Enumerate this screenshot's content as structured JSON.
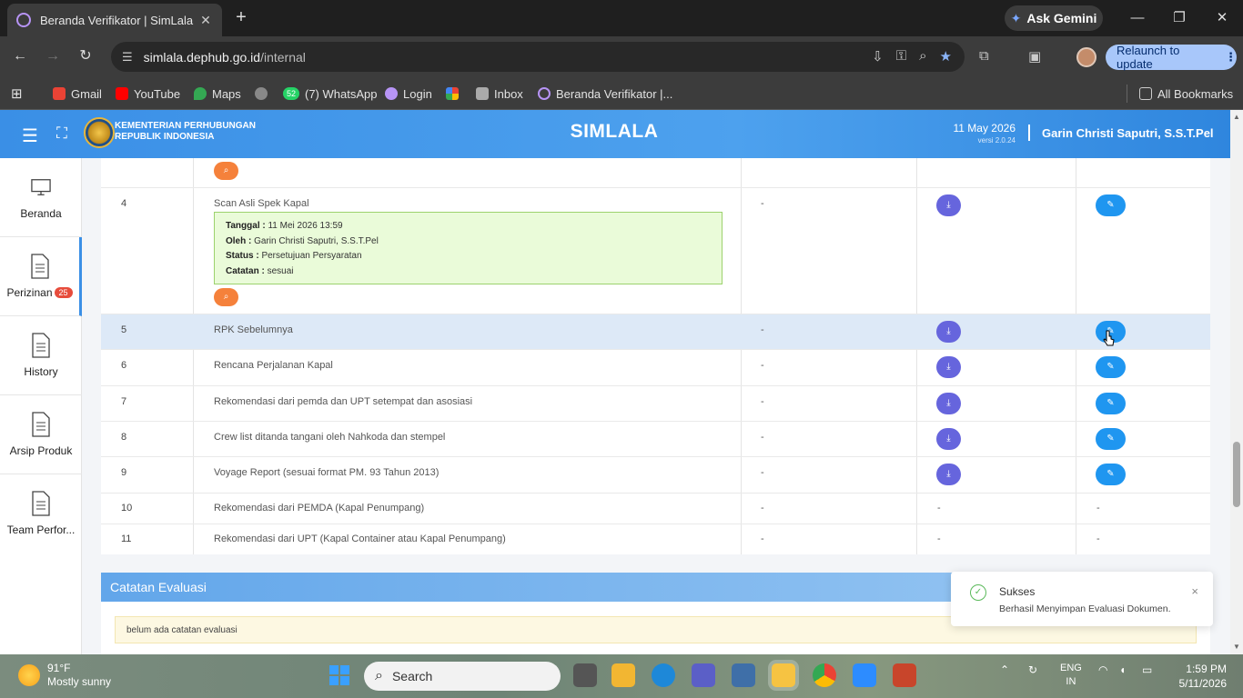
{
  "browser": {
    "tab_title": "Beranda Verifikator | SimLala",
    "ask_gemini": "Ask Gemini",
    "url_host": "simlala.dephub.go.id",
    "url_path": "/internal",
    "relaunch": "Relaunch to update",
    "bookmarks": [
      {
        "label": "Gmail",
        "icon": "gmail-icon"
      },
      {
        "label": "YouTube",
        "icon": "youtube-icon"
      },
      {
        "label": "Maps",
        "icon": "maps-icon"
      },
      {
        "label": "",
        "icon": "globe-icon"
      },
      {
        "label": "(7) WhatsApp",
        "icon": "whatsapp-icon",
        "badge": "52"
      },
      {
        "label": "Login",
        "icon": "login-icon"
      },
      {
        "label": "",
        "icon": "pinwheel-icon"
      },
      {
        "label": "Inbox",
        "icon": "inbox-icon"
      },
      {
        "label": "Beranda Verifikator |...",
        "icon": "simlala-icon"
      }
    ],
    "all_bookmarks": "All Bookmarks"
  },
  "header": {
    "ministry_line1": "KEMENTERIAN PERHUBUNGAN",
    "ministry_line2": "REPUBLIK INDONESIA",
    "app_title": "SIMLALA",
    "date": "11 May 2026",
    "version": "versi 2.0.24",
    "user": "Garin Christi Saputri, S.S.T.Pel"
  },
  "sidebar": {
    "items": [
      {
        "label": "Beranda",
        "icon": "monitor-icon"
      },
      {
        "label": "Perizinan",
        "icon": "document-icon",
        "badge": "25"
      },
      {
        "label": "History",
        "icon": "document-icon"
      },
      {
        "label": "Arsip Produk",
        "icon": "document-icon"
      },
      {
        "label": "Team Perfor...",
        "icon": "document-icon"
      }
    ]
  },
  "table": {
    "rows": [
      {
        "no": "4",
        "name": "Scan Asli Spek Kapal",
        "col3": "-",
        "info": {
          "tanggal_label": "Tanggal :",
          "tanggal": "11 Mei 2026 13:59",
          "oleh_label": "Oleh :",
          "oleh": "Garin Christi Saputri, S.S.T.Pel",
          "status_label": "Status :",
          "status": "Persetujuan Persyaratan",
          "catatan_label": "Catatan :",
          "catatan": "sesuai"
        }
      },
      {
        "no": "5",
        "name": "RPK Sebelumnya",
        "col3": "-"
      },
      {
        "no": "6",
        "name": "Rencana Perjalanan Kapal",
        "col3": "-"
      },
      {
        "no": "7",
        "name": "Rekomendasi dari pemda dan UPT setempat dan asosiasi",
        "col3": "-"
      },
      {
        "no": "8",
        "name": "Crew list ditanda tangani oleh Nahkoda dan stempel",
        "col3": "-"
      },
      {
        "no": "9",
        "name": "Voyage Report (sesuai format PM. 93 Tahun 2013)",
        "col3": "-"
      },
      {
        "no": "10",
        "name": "Rekomendasi dari PEMDA (Kapal Penumpang)",
        "col3": "-",
        "col4": "-",
        "col5": "-"
      },
      {
        "no": "11",
        "name": "Rekomendasi dari UPT (Kapal Container atau Kapal Penumpang)",
        "col3": "-",
        "col4": "-",
        "col5": "-"
      }
    ]
  },
  "evaluasi": {
    "title": "Catatan Evaluasi",
    "note": "belum ada catatan evaluasi"
  },
  "toast": {
    "title": "Sukses",
    "message": "Berhasil Menyimpan Evaluasi Dokumen."
  },
  "taskbar": {
    "temp": "91°F",
    "weather": "Mostly sunny",
    "search": "Search",
    "lang1": "ENG",
    "lang2": "IN",
    "time": "1:59 PM",
    "date": "5/11/2026"
  },
  "colors": {
    "header_blue": "#3a8fe6",
    "download_btn": "#6665dd",
    "edit_btn": "#1f96f0",
    "search_btn": "#f5813b",
    "highlight_row": "#dde9f7",
    "success_box": "#eafbd9"
  }
}
